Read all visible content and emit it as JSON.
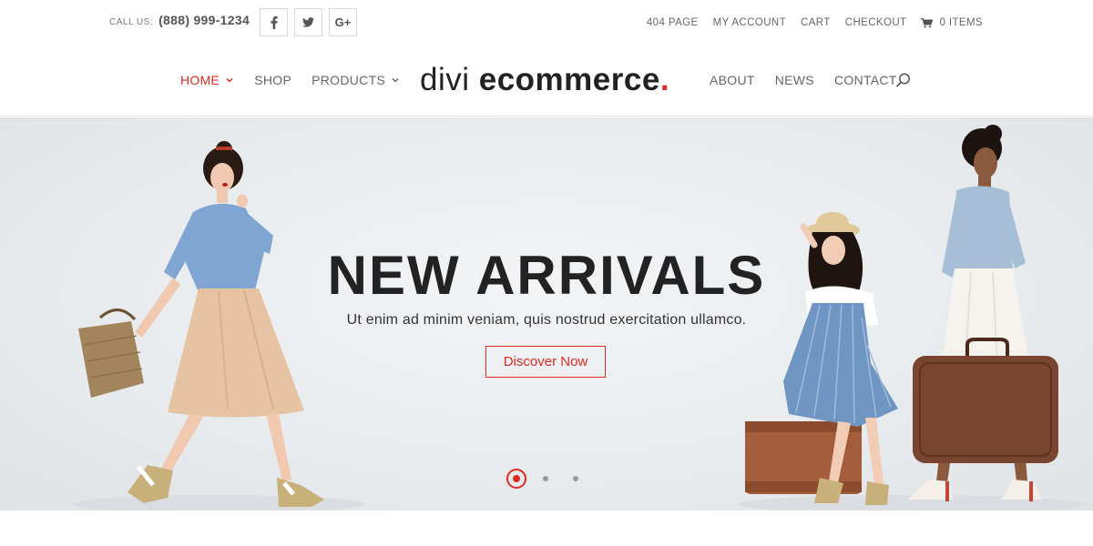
{
  "topbar": {
    "call_label": "CALL US:",
    "phone": "(888) 999-1234",
    "social": [
      {
        "icon": "facebook-icon",
        "glyph": "f"
      },
      {
        "icon": "twitter-icon",
        "glyph": "twitter"
      },
      {
        "icon": "google-plus-icon",
        "glyph": "G+"
      }
    ],
    "links": [
      "404 PAGE",
      "MY ACCOUNT",
      "CART",
      "CHECKOUT"
    ],
    "cart_items": "0 ITEMS"
  },
  "nav": {
    "left": [
      {
        "label": "HOME",
        "active": true,
        "dropdown": true
      },
      {
        "label": "SHOP",
        "active": false,
        "dropdown": false
      },
      {
        "label": "PRODUCTS",
        "active": false,
        "dropdown": true
      }
    ],
    "right": [
      {
        "label": "ABOUT"
      },
      {
        "label": "NEWS"
      },
      {
        "label": "CONTACT"
      }
    ]
  },
  "logo": {
    "light": "divi ",
    "bold": "ecommerce",
    "dot": "."
  },
  "hero": {
    "title": "NEW ARRIVALS",
    "subtitle": "Ut enim ad minim veniam, quis nostrud exercitation ullamco.",
    "cta_label": "Discover Now",
    "slides": 3,
    "active_slide": 1
  },
  "colors": {
    "accent": "#e02b20",
    "text_dark": "#222222",
    "nav_text": "#666666"
  }
}
